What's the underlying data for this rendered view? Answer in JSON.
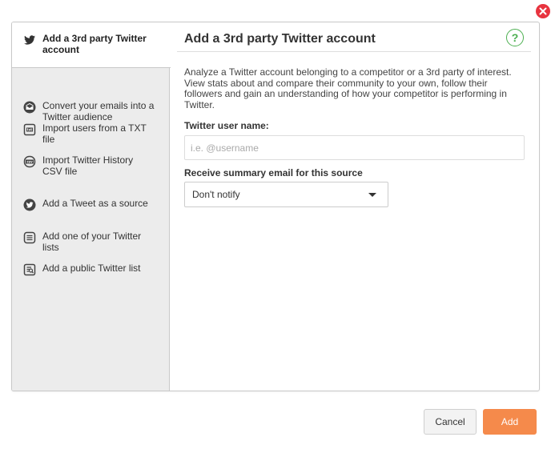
{
  "sidebar": {
    "items": [
      {
        "label": "Add a 3rd party Twitter account",
        "icon": "twitter-bird-icon"
      },
      {
        "label": "Convert your emails into a Twitter audience",
        "icon": "envelope-icon"
      },
      {
        "label": "Import users from a TXT file",
        "icon": "txt-file-icon"
      },
      {
        "label": "Import Twitter History CSV file",
        "icon": "csv-file-icon"
      },
      {
        "label": "Add a Tweet as a source",
        "icon": "twitter-circle-icon"
      },
      {
        "label": "Add one of your Twitter lists",
        "icon": "list-icon"
      },
      {
        "label": "Add a public Twitter list",
        "icon": "public-list-icon"
      }
    ]
  },
  "main": {
    "title": "Add a 3rd party Twitter account",
    "help": "?",
    "description": "Analyze a Twitter account belonging to a competitor or a 3rd party of interest. View stats about and compare their community to your own, follow their followers and gain an understanding of how your competitor is performing in Twitter.",
    "username_label": "Twitter user name:",
    "username_placeholder": "i.e. @username",
    "username_value": "",
    "email_label": "Receive summary email for this source",
    "email_selected": "Don't notify"
  },
  "footer": {
    "cancel_label": "Cancel",
    "add_label": "Add"
  },
  "colors": {
    "accent": "#f58a4b",
    "close": "#e8343f",
    "help": "#4caf50"
  }
}
